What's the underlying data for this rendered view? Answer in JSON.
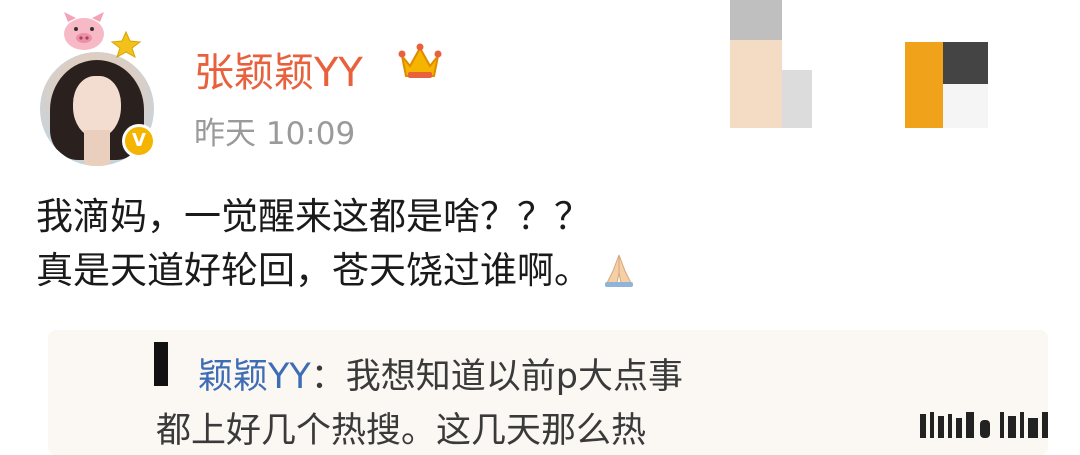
{
  "post": {
    "username": "张颖颖YY",
    "timestamp": "昨天 10:09",
    "verified_badge": "V",
    "body_line1": "我滴妈，一觉醒来这都是啥？？？",
    "body_line2": "真是天道好轮回，苍天饶过谁啊。",
    "emoji": "pray-icon"
  },
  "quote": {
    "user": "颖颖YY",
    "text_line1": "：我想知道以前p大点事",
    "text_line2": "都上好几个热搜。这几天那么热"
  },
  "colors": {
    "username": "#e8603c",
    "timestamp": "#9a9a9a",
    "quote_user": "#3d6db5",
    "badge": "#f5b400",
    "quote_bg": "#fbf7f3"
  }
}
